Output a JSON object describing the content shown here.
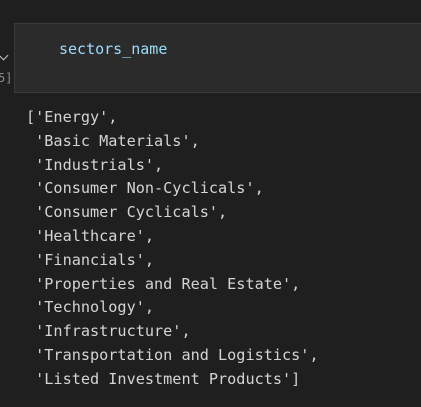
{
  "cell": {
    "exec_count_label": "5]",
    "code": "sectors_name",
    "output_lines": [
      "['Energy',",
      " 'Basic Materials',",
      " 'Industrials',",
      " 'Consumer Non-Cyclicals',",
      " 'Consumer Cyclicals',",
      " 'Healthcare',",
      " 'Financials',",
      " 'Properties and Real Estate',",
      " 'Technology',",
      " 'Infrastructure',",
      " 'Transportation and Logistics',",
      " 'Listed Investment Products']"
    ]
  },
  "icons": {
    "collapse": "chevron-down-icon"
  },
  "colors": {
    "background": "#1f1f1f",
    "editor_background": "#2b2b2b",
    "variable": "#9cdcfe",
    "output_text": "#d4d4d4"
  }
}
